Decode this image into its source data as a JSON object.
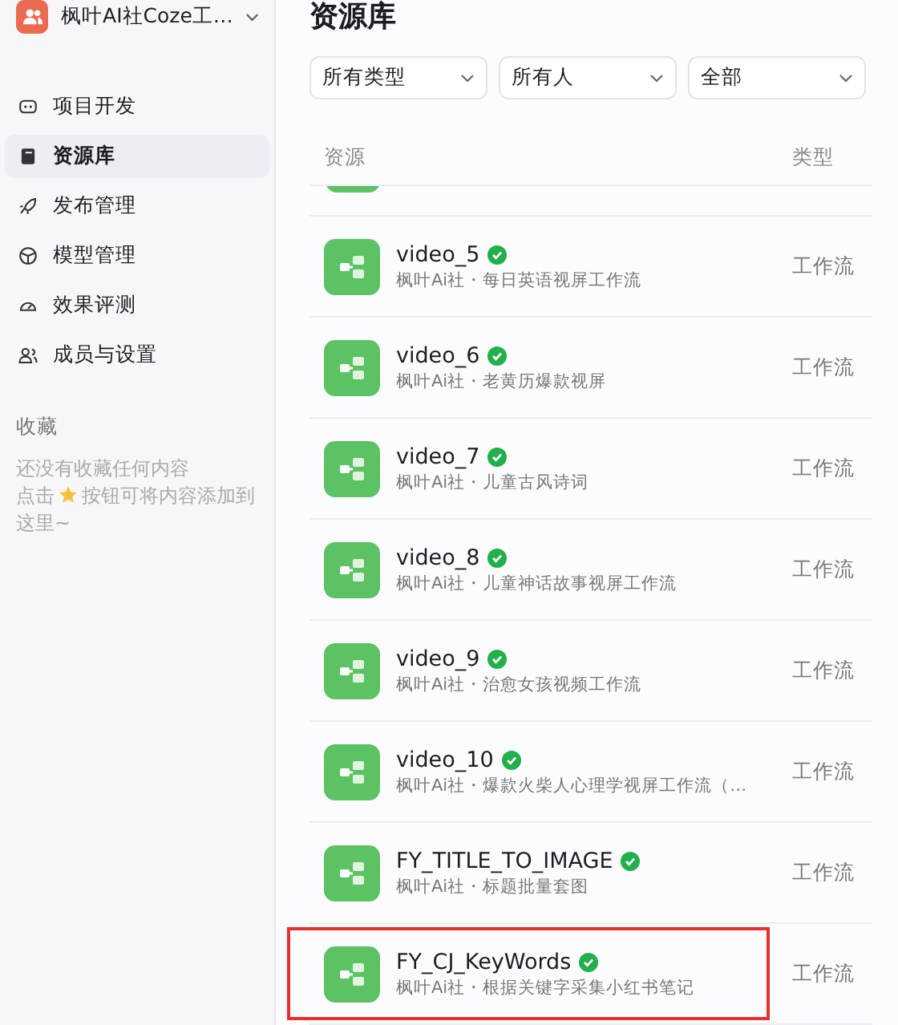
{
  "workspace": {
    "name": "枫叶AI社Coze工…"
  },
  "nav": [
    {
      "label": "项目开发",
      "selected": false
    },
    {
      "label": "资源库",
      "selected": true
    },
    {
      "label": "发布管理",
      "selected": false
    },
    {
      "label": "模型管理",
      "selected": false
    },
    {
      "label": "效果评测",
      "selected": false
    },
    {
      "label": "成员与设置",
      "selected": false
    }
  ],
  "favorites": {
    "title": "收藏",
    "empty_line_1": "还没有收藏任何内容",
    "empty_line_2_before": "点击",
    "empty_line_2_after": "按钮可将内容添加到这里~"
  },
  "page_title": "资源库",
  "filters": [
    {
      "value": "所有类型"
    },
    {
      "value": "所有人"
    },
    {
      "value": "全部"
    }
  ],
  "table": {
    "columns": [
      "资源",
      "类型"
    ],
    "rows": [
      {
        "name": "video_5",
        "description": "枫叶Ai社・每日英语视屏工作流",
        "type": "工作流",
        "verified": true,
        "highlighted": false
      },
      {
        "name": "video_6",
        "description": "枫叶Ai社・老黄历爆款视屏",
        "type": "工作流",
        "verified": true,
        "highlighted": false
      },
      {
        "name": "video_7",
        "description": "枫叶Ai社・儿童古风诗词",
        "type": "工作流",
        "verified": true,
        "highlighted": false
      },
      {
        "name": "video_8",
        "description": "枫叶Ai社・儿童神话故事视屏工作流",
        "type": "工作流",
        "verified": true,
        "highlighted": false
      },
      {
        "name": "video_9",
        "description": "枫叶Ai社・治愈女孩视频工作流",
        "type": "工作流",
        "verified": true,
        "highlighted": false
      },
      {
        "name": "video_10",
        "description": "枫叶Ai社・爆款火柴人心理学视屏工作流（…",
        "type": "工作流",
        "verified": true,
        "highlighted": false
      },
      {
        "name": "FY_TITLE_TO_IMAGE",
        "description": "枫叶Ai社・标题批量套图",
        "type": "工作流",
        "verified": true,
        "highlighted": false
      },
      {
        "name": "FY_CJ_KeyWords",
        "description": "枫叶Ai社・根据关键字采集小红书笔记",
        "type": "工作流",
        "verified": true,
        "highlighted": true
      }
    ]
  }
}
